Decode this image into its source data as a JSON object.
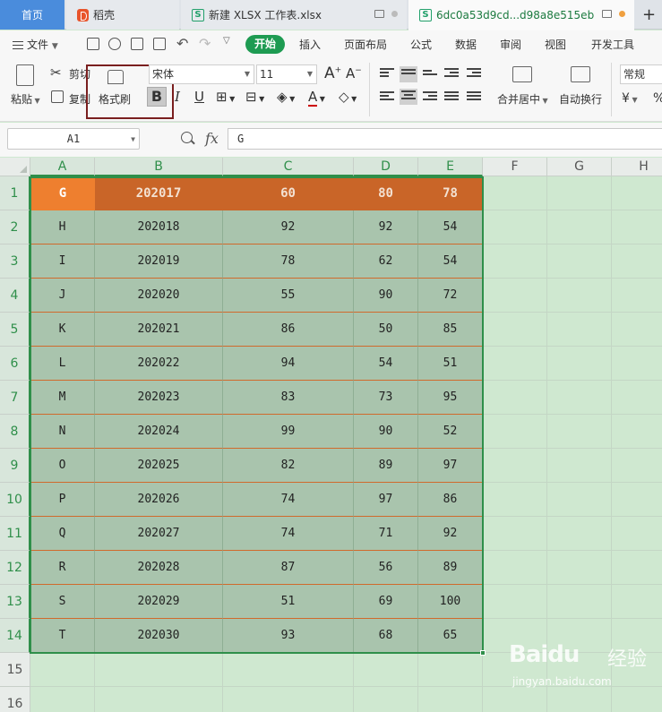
{
  "tabs": [
    {
      "label": "首页"
    },
    {
      "label": "稻壳"
    },
    {
      "label": "新建 XLSX 工作表.xlsx"
    },
    {
      "label": "6dc0a53d9cd...d98a8e515eb"
    }
  ],
  "tab_add": "+",
  "menu": {
    "file": "文件",
    "items": [
      "开始",
      "插入",
      "页面布局",
      "公式",
      "数据",
      "审阅",
      "视图",
      "开发工具"
    ]
  },
  "ribbon": {
    "paste": "粘贴",
    "cut": "剪切",
    "copy": "复制",
    "format_painter": "格式刷",
    "font_name": "宋体",
    "font_size": "11",
    "font_grow": "A",
    "font_shrink": "A",
    "bold": "B",
    "italic": "I",
    "underline": "U",
    "merge_center": "合并居中",
    "wrap_text": "自动换行",
    "number_format": "常规",
    "currency": "¥",
    "percent": "%"
  },
  "formula_bar": {
    "name_box": "A1",
    "fx": "fx",
    "content": "G"
  },
  "columns": [
    "A",
    "B",
    "C",
    "D",
    "E",
    "F",
    "G",
    "H"
  ],
  "rows": [
    "1",
    "2",
    "3",
    "4",
    "5",
    "6",
    "7",
    "8",
    "9",
    "10",
    "11",
    "12",
    "13",
    "14",
    "15",
    "16"
  ],
  "table": [
    [
      "G",
      "202017",
      "60",
      "80",
      "78"
    ],
    [
      "H",
      "202018",
      "92",
      "92",
      "54"
    ],
    [
      "I",
      "202019",
      "78",
      "62",
      "54"
    ],
    [
      "J",
      "202020",
      "55",
      "90",
      "72"
    ],
    [
      "K",
      "202021",
      "86",
      "50",
      "85"
    ],
    [
      "L",
      "202022",
      "94",
      "54",
      "51"
    ],
    [
      "M",
      "202023",
      "83",
      "73",
      "95"
    ],
    [
      "N",
      "202024",
      "99",
      "90",
      "52"
    ],
    [
      "O",
      "202025",
      "82",
      "89",
      "97"
    ],
    [
      "P",
      "202026",
      "74",
      "97",
      "86"
    ],
    [
      "Q",
      "202027",
      "74",
      "71",
      "92"
    ],
    [
      "R",
      "202028",
      "87",
      "56",
      "89"
    ],
    [
      "S",
      "202029",
      "51",
      "69",
      "100"
    ],
    [
      "T",
      "202030",
      "93",
      "68",
      "65"
    ]
  ],
  "watermark": {
    "brand": "Baidu",
    "cn": "经验",
    "url": "jingyan.baidu.com"
  },
  "colors": {
    "accent_green": "#1e9b52",
    "header_orange": "#c96528",
    "active_orange": "#ee7f2f",
    "sheet_bg": "#cfe8d0"
  }
}
